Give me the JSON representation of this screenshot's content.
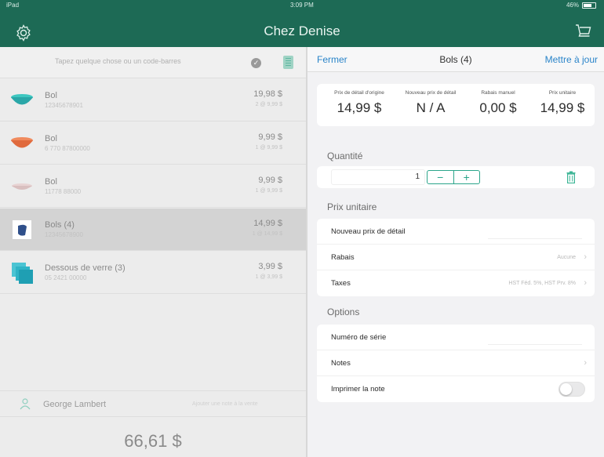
{
  "status": {
    "carrier": "iPad",
    "time": "3:09 PM",
    "battery": "46%"
  },
  "app": {
    "title": "Chez Denise"
  },
  "search": {
    "placeholder": "Tapez quelque chose ou un code-barres"
  },
  "items": [
    {
      "name": "Bol",
      "sku": "12345678901",
      "price": "19,98 $",
      "unit": "2 @ 9,99 $",
      "thumb": "teal-bowl"
    },
    {
      "name": "Bol",
      "sku": "6 770 87800000",
      "price": "9,99 $",
      "unit": "1 @ 9,99 $",
      "thumb": "orange-bowl"
    },
    {
      "name": "Bol",
      "sku": "11778 88000",
      "price": "9,99 $",
      "unit": "1 @ 9,99 $",
      "thumb": "pink-bowl"
    },
    {
      "name": "Bols (4)",
      "sku": "12345678900",
      "price": "14,99 $",
      "unit": "1 @ 14,99 $",
      "thumb": "blue-bowls"
    },
    {
      "name": "Dessous de verre (3)",
      "sku": "05 2421 00000",
      "price": "3,99 $",
      "unit": "1 @ 3,99 $",
      "thumb": "teal-coasters"
    }
  ],
  "customer": {
    "name": "George Lambert",
    "note": "Ajouter une note à la vente"
  },
  "total": "66,61 $",
  "detail": {
    "close": "Fermer",
    "title": "Bols (4)",
    "update": "Mettre à jour",
    "prices": [
      {
        "label": "Prix de détail d'origine",
        "value": "14,99 $"
      },
      {
        "label": "Nouveau prix de détail",
        "value": "N / A"
      },
      {
        "label": "Rabais manuel",
        "value": "0,00 $"
      },
      {
        "label": "Prix unitaire",
        "value": "14,99 $"
      }
    ],
    "quantity_label": "Quantité",
    "quantity": "1",
    "minus": "−",
    "plus": "+",
    "unit_price_label": "Prix unitaire",
    "new_price_label": "Nouveau prix de détail",
    "discount_label": "Rabais",
    "discount_value": "Aucune",
    "taxes_label": "Taxes",
    "taxes_value": "HST Féd. 5%, HST Prv. 8%",
    "options_label": "Options",
    "serial_label": "Numéro de série",
    "notes_label": "Notes",
    "print_label": "Imprimer la note",
    "print_enabled": false
  },
  "colors": {
    "brand": "#1d6a55",
    "accent": "#2a84c9",
    "stepper": "#2ba58a"
  }
}
